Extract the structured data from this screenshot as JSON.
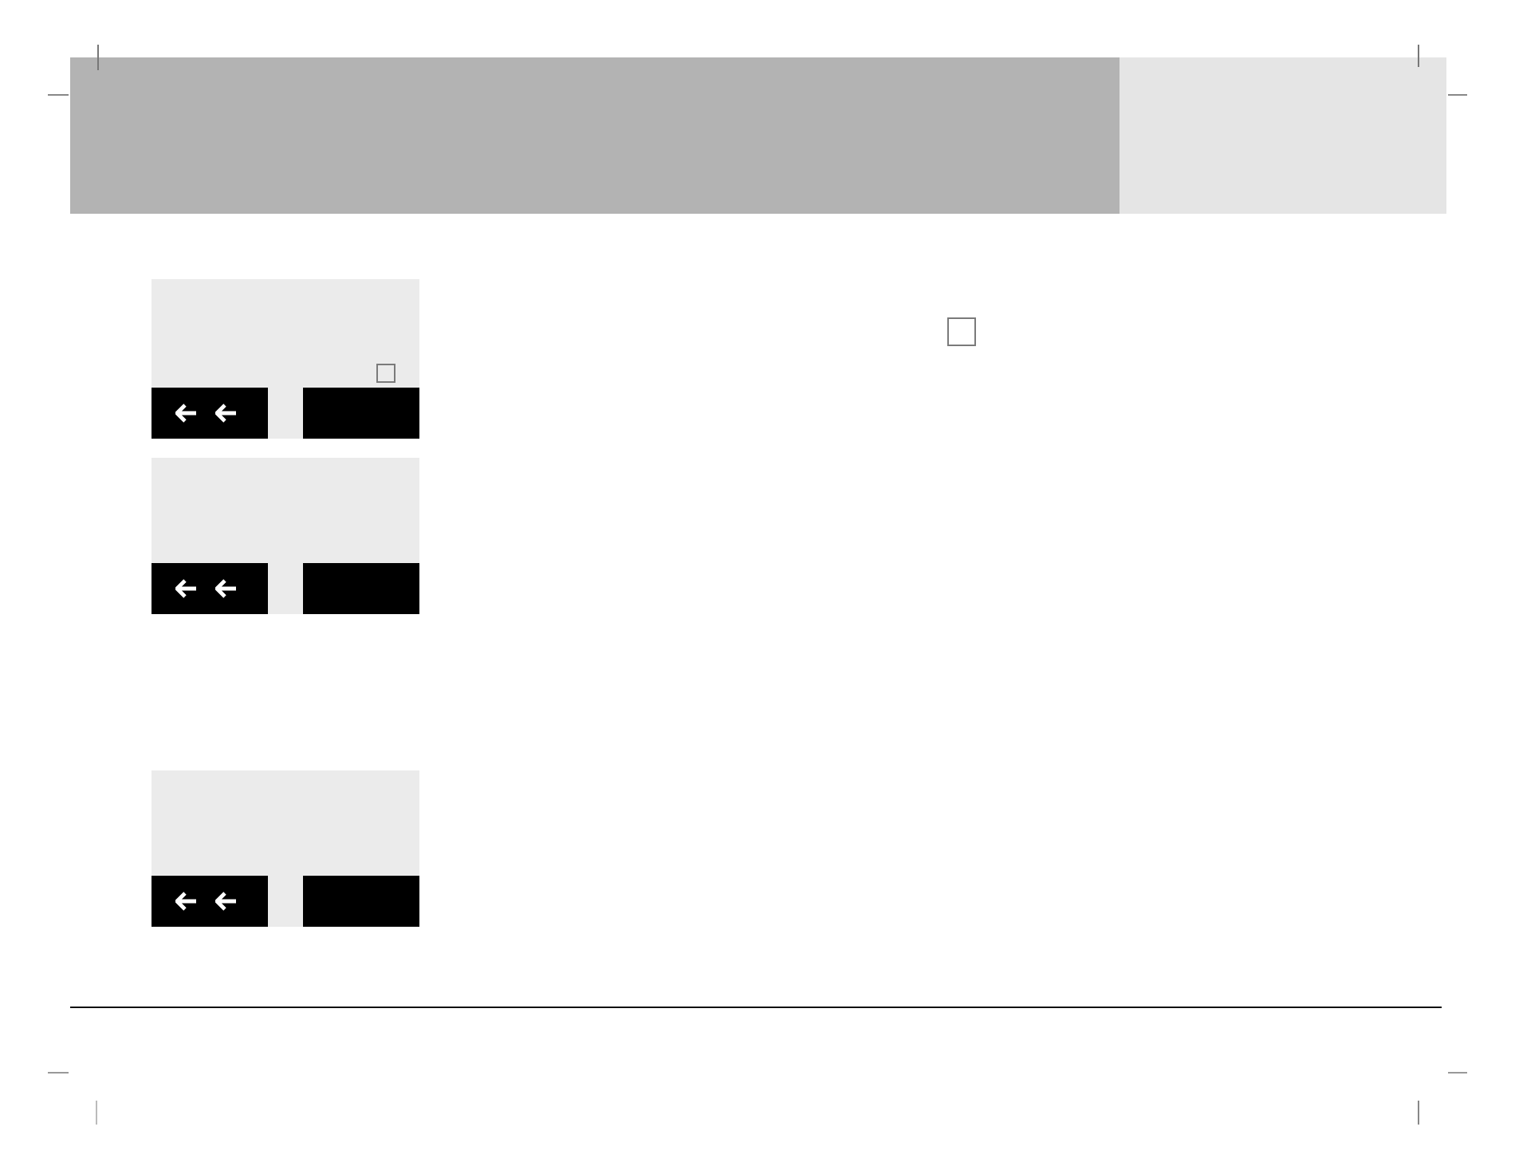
{
  "display_screens": [
    {
      "kind": "with_checkbox",
      "checked": false
    },
    {
      "kind": "plain"
    },
    {
      "kind": "plain"
    }
  ],
  "checkbox": {
    "checked": false
  }
}
